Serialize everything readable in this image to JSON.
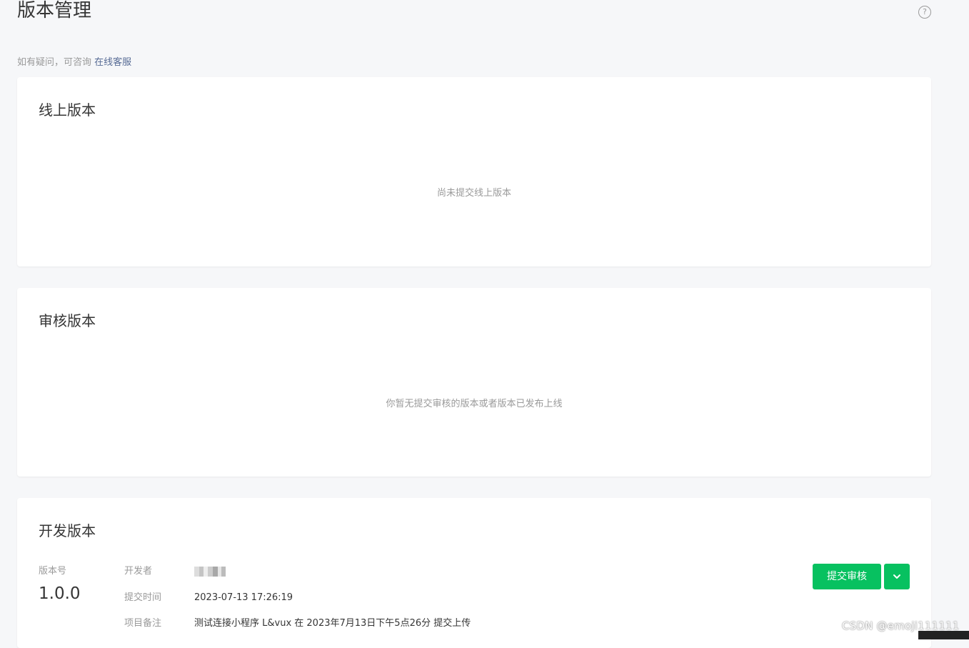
{
  "header": {
    "title": "版本管理",
    "help_icon": "?",
    "hint_prefix": "如有疑问，可咨询 ",
    "hint_link": "在线客服"
  },
  "online": {
    "title": "线上版本",
    "empty": "尚未提交线上版本"
  },
  "review": {
    "title": "审核版本",
    "empty": "你暂无提交审核的版本或者版本已发布上线"
  },
  "dev": {
    "title": "开发版本",
    "version_label": "版本号",
    "version_number": "1.0.0",
    "developer_label": "开发者",
    "submit_time_label": "提交时间",
    "submit_time": "2023-07-13 17:26:19",
    "remark_label": "项目备注",
    "remark": "测试连接小程序 L&vux 在 2023年7月13日下午5点26分 提交上传",
    "submit_button": "提交审核"
  },
  "watermark": "CSDN @emoji111111",
  "colors": {
    "accent": "#07c160",
    "link": "#576b95",
    "background": "#f6f7f9"
  }
}
